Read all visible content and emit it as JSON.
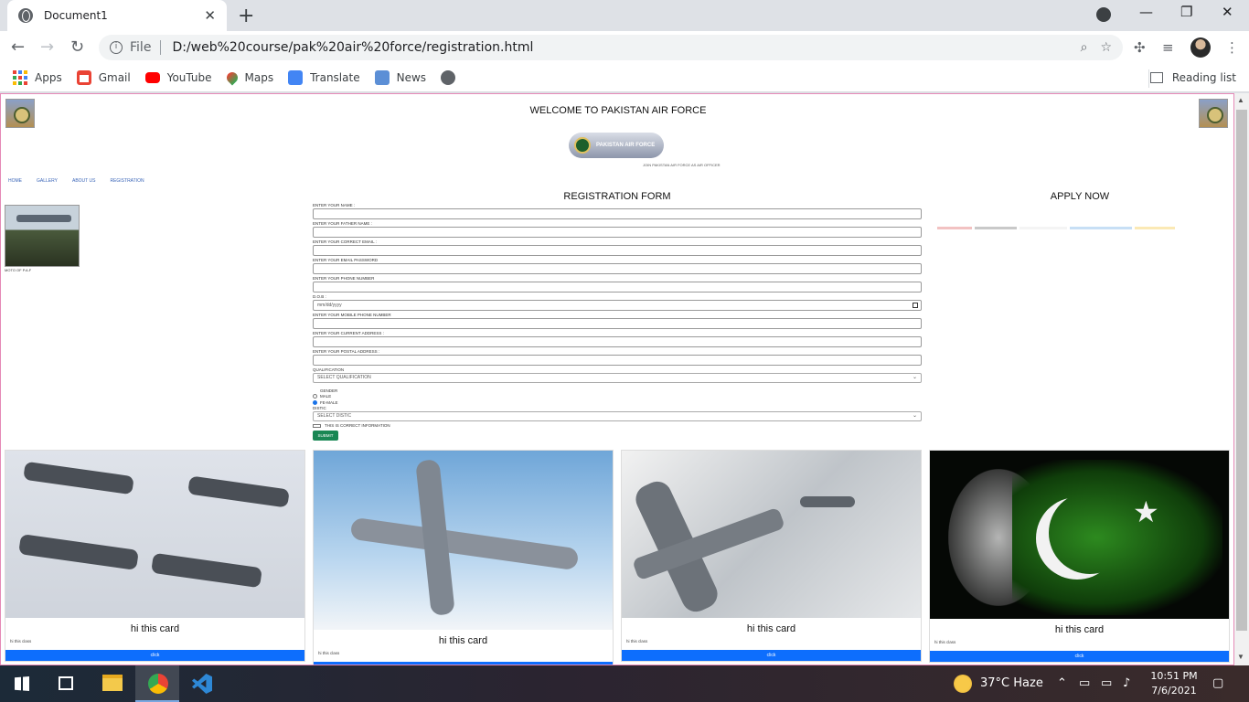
{
  "browser": {
    "tab_title": "Document1",
    "file_label": "File",
    "url": "D:/web%20course/pak%20air%20force/registration.html",
    "bookmarks": [
      "Apps",
      "Gmail",
      "YouTube",
      "Maps",
      "Translate",
      "News"
    ],
    "reading_list": "Reading list"
  },
  "page": {
    "welcome": "WELCOME TO PAKISTAN AIR FORCE",
    "logo_text": "PAKISTAN AIR FORCE",
    "join_text": "JOIN PAKISTAN AIR FORCE AS AIR OFFICER",
    "nav": [
      "HOME",
      "GALLERY",
      "ABOUT US",
      "REGISTRATION"
    ],
    "thumb_caption": "MOTO OF P.A.F",
    "form_title": "REGISTRATION FORM",
    "apply_title": "APPLY NOW",
    "apply_bar_colors": [
      "#f2c2c2",
      "#c9c9c9",
      "#f4f4f4",
      "#c7dff5",
      "#fbe9b5"
    ],
    "form": {
      "labels": [
        "ENTER YOUR NAME :",
        "ENTER YOUR FATHER NAME :",
        "ENTER YOUR CORRECT EMAIL :",
        "ENTER YOUR EMAIL PASSWORD",
        "ENTER YOUR PHONE NUMBER",
        "D.O.B :",
        "ENTER YOUR MOBILE PHONE NUMBER",
        "ENTER YOUR CURRENT ADDRESS :",
        "ENTER YOUR POSTAL ADDRESS :"
      ],
      "dob_placeholder": "mm/dd/yyyy",
      "qualification_label": "QUALIFICATION",
      "qualification_value": "SELECT QUALIFICATION",
      "gender_label": "GENDER",
      "gender_options": [
        "MALE",
        "FE-MALE"
      ],
      "gender_selected_index": 1,
      "district_label": "DISTIC",
      "district_value": "SELECT DISTIC",
      "confirm_label": "THIS IS CORRECT INFORMATION",
      "submit_label": "SUBMIT"
    },
    "cards": [
      {
        "title": "hi this card",
        "text": "hi this class",
        "button": "click"
      },
      {
        "title": "hi this card",
        "text": "hi this class",
        "button": ""
      },
      {
        "title": "hi this card",
        "text": "hi this class",
        "button": "click"
      },
      {
        "title": "hi this card",
        "text": "hi this class",
        "button": "click"
      }
    ]
  },
  "taskbar": {
    "weather": "37°C  Haze",
    "time": "10:51 PM",
    "date": "7/6/2021"
  }
}
